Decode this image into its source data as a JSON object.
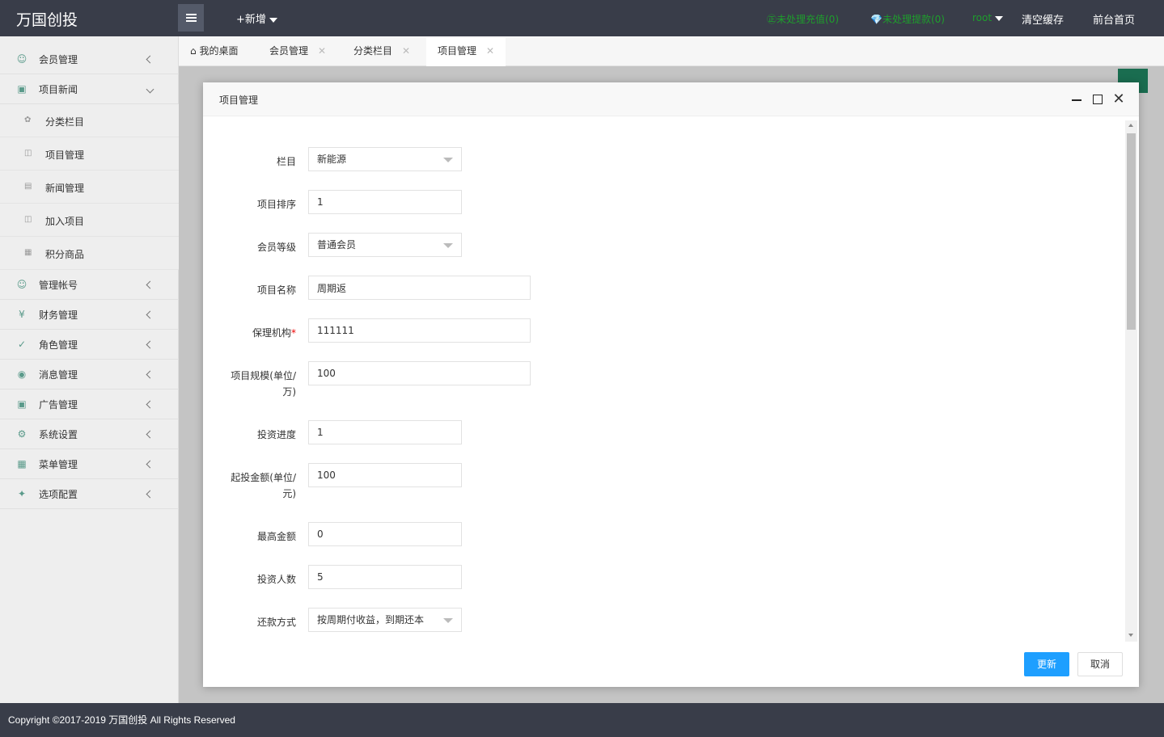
{
  "header": {
    "logo": "万国创投",
    "add_new": "+新增",
    "pending_recharge": "㊣未处理充值(0)",
    "pending_withdraw": "💎未处理提款(0)",
    "user": "root",
    "clear_cache": "清空缓存",
    "frontend_home": "前台首页"
  },
  "sidebar": {
    "items": [
      {
        "label": "会员管理",
        "icon": "user-icon"
      },
      {
        "label": "项目新闻",
        "icon": "book-icon"
      },
      {
        "label": "管理帐号",
        "icon": "admin-icon"
      },
      {
        "label": "财务管理",
        "icon": "yen-icon"
      },
      {
        "label": "角色管理",
        "icon": "shield-icon"
      },
      {
        "label": "消息管理",
        "icon": "message-icon"
      },
      {
        "label": "广告管理",
        "icon": "image-icon"
      },
      {
        "label": "系统设置",
        "icon": "gear-icon"
      },
      {
        "label": "菜单管理",
        "icon": "grid-icon"
      },
      {
        "label": "选项配置",
        "icon": "config-icon"
      }
    ],
    "sub_items": [
      {
        "label": "分类栏目"
      },
      {
        "label": "项目管理"
      },
      {
        "label": "新闻管理"
      },
      {
        "label": "加入项目"
      },
      {
        "label": "积分商品"
      }
    ]
  },
  "tabs": [
    {
      "label": "我的桌面"
    },
    {
      "label": "会员管理"
    },
    {
      "label": "分类栏目"
    },
    {
      "label": "项目管理"
    }
  ],
  "modal": {
    "title": "项目管理",
    "fields": {
      "category": {
        "label": "栏目",
        "value": "新能源"
      },
      "sort": {
        "label": "项目排序",
        "value": "1"
      },
      "member_level": {
        "label": "会员等级",
        "value": "普通会员"
      },
      "name": {
        "label": "项目名称",
        "value": "周期返"
      },
      "guarantor": {
        "label": "保理机构",
        "required_mark": "*",
        "value": "111111"
      },
      "scale": {
        "label": "项目规模(单位/万)",
        "value": "100"
      },
      "progress": {
        "label": "投资进度",
        "value": "1"
      },
      "min_amount": {
        "label": "起投金额(单位/元)",
        "value": "100"
      },
      "max_amount": {
        "label": "最高金额",
        "value": "0"
      },
      "investors": {
        "label": "投资人数",
        "value": "5"
      },
      "repayment": {
        "label": "还款方式",
        "value": "按周期付收益，到期还本"
      }
    },
    "update_button": "更新",
    "cancel_button": "取消"
  },
  "footer": {
    "copyright": "Copyright ©2017-2019 万国创投 All Rights Reserved"
  }
}
